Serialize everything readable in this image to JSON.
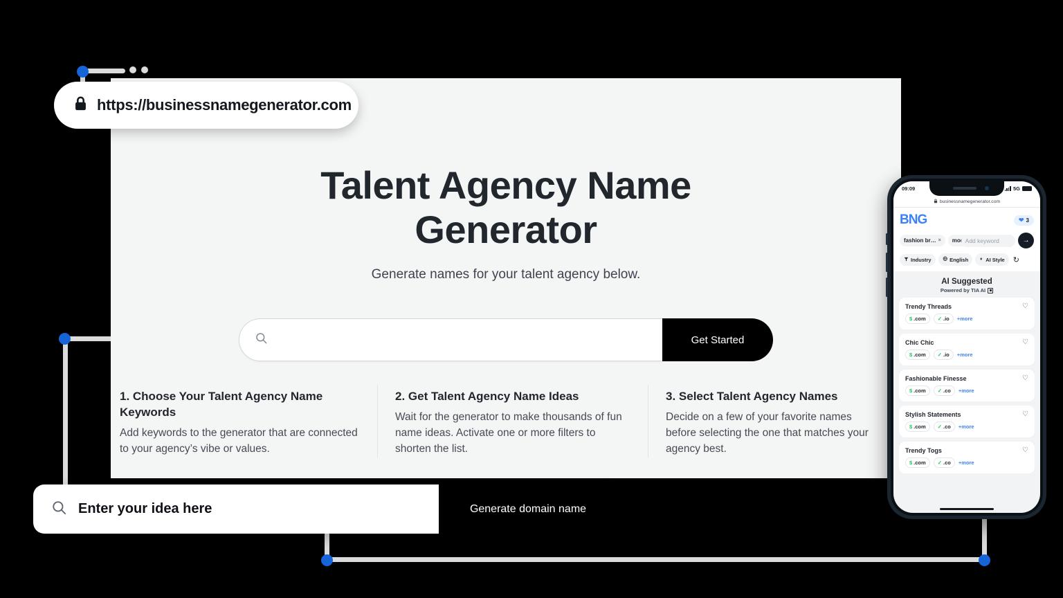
{
  "browser": {
    "url": "https://businessnamegenerator.com",
    "lock_icon": "lock-icon"
  },
  "hero": {
    "title": "Talent Agency Name Generator",
    "subtitle": "Generate names for your talent agency below."
  },
  "search": {
    "placeholder": "",
    "value": "",
    "button_label": "Get Started",
    "icon": "search-icon"
  },
  "steps": [
    {
      "title": "1. Choose Your Talent Agency Name Keywords",
      "body": "Add keywords to the generator that are connected to your agency’s vibe or values."
    },
    {
      "title": "2. Get Talent Agency Name Ideas",
      "body": "Wait for the generator to make thousands of fun name ideas. Activate one or more filters to shorten the list."
    },
    {
      "title": "3. Select Talent Agency Names",
      "body": "Decide on a few of your favorite names before selecting the one that matches your agency best."
    }
  ],
  "bottom_bar": {
    "placeholder": "Enter your idea here",
    "value": "",
    "button_label": "Generate domain name",
    "icon": "search-icon"
  },
  "phone": {
    "status": {
      "time": "09:09",
      "network": "5G"
    },
    "url": "businessnamegenerator.com",
    "logo": "BNG",
    "favorites_count": "3",
    "keywords": [
      {
        "label": "fashion br…",
        "remove": "×"
      },
      {
        "label": "mod",
        "remove": ""
      }
    ],
    "keyword_placeholder": "Add keyword",
    "go_icon": "arrow-right-icon",
    "filters": [
      {
        "label": "Industry",
        "icon": "funnel-icon"
      },
      {
        "label": "English",
        "icon": "globe-icon"
      },
      {
        "label": "AI Style",
        "icon": "bolt-icon"
      }
    ],
    "refresh_icon": "refresh-icon",
    "section_title": "AI Suggested",
    "section_sub": "Powered by TIA AI",
    "results": [
      {
        "name": "Trendy Threads",
        "tlds": [
          ".com",
          ".io"
        ],
        "more": "+more"
      },
      {
        "name": "Chic Chic",
        "tlds": [
          ".com",
          ".io"
        ],
        "more": "+more"
      },
      {
        "name": "Fashionable Finesse",
        "tlds": [
          ".com",
          ".co"
        ],
        "more": "+more"
      },
      {
        "name": "Stylish Statements",
        "tlds": [
          ".com",
          ".co"
        ],
        "more": "+more"
      },
      {
        "name": "Trendy Togs",
        "tlds": [
          ".com",
          ".co"
        ],
        "more": "+more"
      }
    ]
  },
  "colors": {
    "accent_blue": "#1565d8",
    "logo_blue": "#3b82f6",
    "link_blue": "#3b82f6",
    "available_green": "#22c55e",
    "page_bg": "#f4f5f5",
    "dark": "#000000"
  }
}
